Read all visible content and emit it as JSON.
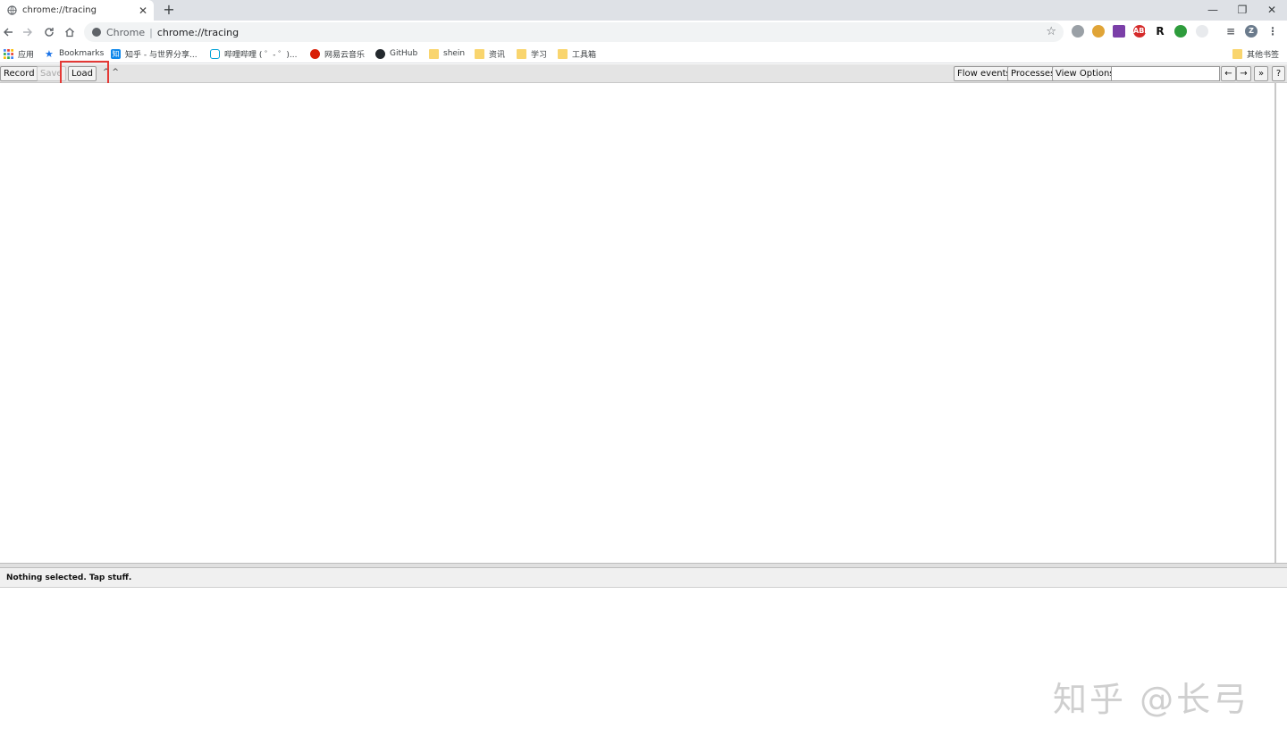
{
  "tab": {
    "title": "chrome://tracing",
    "close": "✕",
    "new_tab": "+"
  },
  "window_controls": {
    "minimize": "—",
    "restore": "❐",
    "close": "✕"
  },
  "toolbar": {
    "omnibox_chip": "Chrome",
    "omnibox_separator": "|",
    "url": "chrome://tracing",
    "extensions": [
      "ABP",
      "R"
    ],
    "profile_initial": "Z"
  },
  "bookmarks": {
    "apps_label": "应用",
    "items": [
      {
        "label": "Bookmarks",
        "icon": "star-icon"
      },
      {
        "label": "知乎 - 与世界分享...",
        "icon": "zhihu-icon"
      },
      {
        "label": "哔哩哔哩 ( ゜- ゜)...",
        "icon": "bilibili-icon"
      },
      {
        "label": "网易云音乐",
        "icon": "netease-music-icon"
      },
      {
        "label": "GitHub",
        "icon": "github-icon"
      },
      {
        "label": "shein",
        "icon": "folder-icon"
      },
      {
        "label": "资讯",
        "icon": "folder-icon"
      },
      {
        "label": "学习",
        "icon": "folder-icon"
      },
      {
        "label": "工具箱",
        "icon": "folder-icon"
      }
    ],
    "other_label": "其他书签"
  },
  "tracing": {
    "record": "Record",
    "save": "Save",
    "load": "Load",
    "arrows": "^ ^",
    "flow_events": "Flow events",
    "processes": "Processes",
    "view_options": "View Options",
    "search_value": "",
    "prev": "←",
    "next": "→",
    "expand": "»",
    "help": "?"
  },
  "analysis": {
    "status": "Nothing selected. Tap stuff."
  },
  "watermark": "知乎 @长弓",
  "colors": {
    "highlight": "#e53935",
    "tab_strip": "#dee1e6"
  }
}
